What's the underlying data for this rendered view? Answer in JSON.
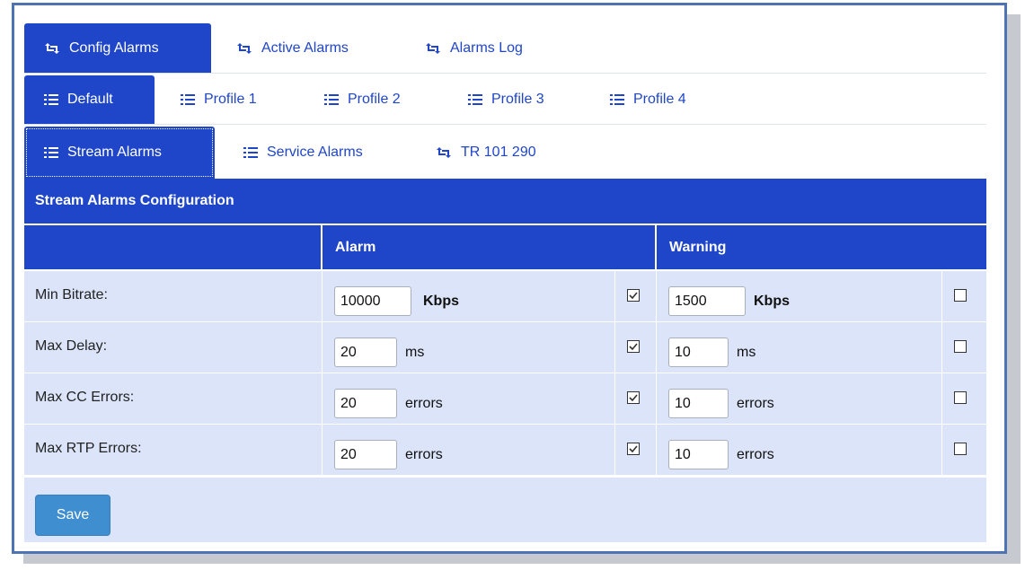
{
  "main_tabs": [
    {
      "label": "Config Alarms",
      "icon": "retweet-icon",
      "active": true
    },
    {
      "label": "Active Alarms",
      "icon": "retweet-icon",
      "active": false
    },
    {
      "label": "Alarms Log",
      "icon": "retweet-icon",
      "active": false
    }
  ],
  "profile_tabs": [
    {
      "label": "Default",
      "icon": "list-icon",
      "active": true
    },
    {
      "label": "Profile 1",
      "icon": "list-icon",
      "active": false
    },
    {
      "label": "Profile 2",
      "icon": "list-icon",
      "active": false
    },
    {
      "label": "Profile 3",
      "icon": "list-icon",
      "active": false
    },
    {
      "label": "Profile 4",
      "icon": "list-icon",
      "active": false
    }
  ],
  "sub_tabs": [
    {
      "label": "Stream Alarms",
      "icon": "list-icon",
      "active": true
    },
    {
      "label": "Service Alarms",
      "icon": "list-icon",
      "active": false
    },
    {
      "label": "TR 101 290",
      "icon": "retweet-icon",
      "active": false
    }
  ],
  "panel": {
    "title": "Stream Alarms Configuration",
    "alarm_header": "Alarm",
    "warning_header": "Warning"
  },
  "rows": [
    {
      "label": "Min Bitrate:",
      "alarm_value": "10000",
      "alarm_unit": "Kbps",
      "alarm_checked": true,
      "warning_value": "1500",
      "warning_unit": "Kbps",
      "warning_checked": false
    },
    {
      "label": "Max Delay:",
      "alarm_value": "20",
      "alarm_unit": "ms",
      "alarm_checked": true,
      "warning_value": "10",
      "warning_unit": "ms",
      "warning_checked": false
    },
    {
      "label": "Max CC Errors:",
      "alarm_value": "20",
      "alarm_unit": "errors",
      "alarm_checked": true,
      "warning_value": "10",
      "warning_unit": "errors",
      "warning_checked": false
    },
    {
      "label": "Max RTP Errors:",
      "alarm_value": "20",
      "alarm_unit": "errors",
      "alarm_checked": true,
      "warning_value": "10",
      "warning_unit": "errors",
      "warning_checked": false
    }
  ],
  "save_label": "Save",
  "colors": {
    "primary": "#1f46c8",
    "row_bg": "#dbe4f8",
    "save_button": "#3f8ed0",
    "frame_border": "#4e73b2"
  }
}
